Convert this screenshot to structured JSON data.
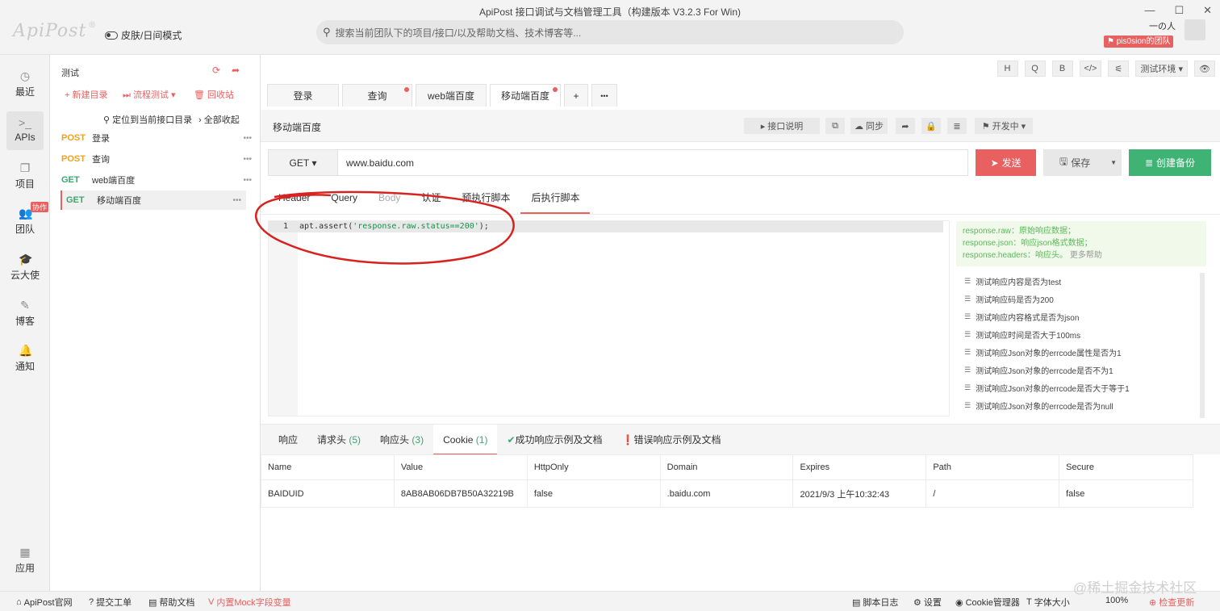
{
  "window": {
    "title": "ApiPost 接口调试与文档管理工具（构建版本 V3.2.3 For Win)",
    "logo": "ApiPost",
    "logo_mark": "®",
    "min": "—",
    "max": "☐",
    "close": "✕"
  },
  "header": {
    "skin_label": "皮肤/日间模式",
    "search_placeholder": "搜索当前团队下的项目/接口/以及帮助文档、技术博客等...",
    "user_name": "一の人",
    "team_badge": "pis0sion的团队"
  },
  "leftnav": {
    "items": [
      {
        "label": "最近",
        "icon": "clock-icon"
      },
      {
        "label": "APIs",
        "icon": "terminal-icon"
      },
      {
        "label": "项目",
        "icon": "project-icon"
      },
      {
        "label": "团队",
        "icon": "team-icon"
      },
      {
        "label": "云大使",
        "icon": "cap-icon"
      },
      {
        "label": "博客",
        "icon": "edit-icon"
      },
      {
        "label": "通知",
        "icon": "bell-icon"
      },
      {
        "label": "应用",
        "icon": "apps-icon"
      }
    ],
    "badge": "协作"
  },
  "tree": {
    "project": "测试",
    "new_dir": "+ 新建目录",
    "flow_test": "⏭ 流程测试",
    "recycle": "回收站",
    "locate": "定位到当前接口目录",
    "collapse": "全部收起",
    "items": [
      {
        "method": "POST",
        "name": "登录"
      },
      {
        "method": "POST",
        "name": "查询"
      },
      {
        "method": "GET",
        "name": "web端百度"
      },
      {
        "method": "GET",
        "name": "移动端百度"
      }
    ],
    "more": "•••"
  },
  "toolbar": {
    "h": "H",
    "q": "Q",
    "b": "B",
    "code": "</>",
    "sliders": "⚟",
    "env": "测试环境",
    "eye": "👁"
  },
  "tabs": {
    "items": [
      "登录",
      "查询",
      "web端百度",
      "移动端百度"
    ],
    "add": "+",
    "more": "•••"
  },
  "api": {
    "title": "移动端百度",
    "doc_btn": "接口说明",
    "sync_btn": "同步",
    "status_btn": "开发中"
  },
  "request": {
    "method": "GET",
    "url": "www.baidu.com",
    "send": "发送",
    "save": "保存",
    "backup": "创建备份"
  },
  "req_tabs": [
    "Header",
    "Query",
    "Body",
    "认证",
    "预执行脚本",
    "后执行脚本"
  ],
  "editor": {
    "line_no": "1",
    "code_pre": "apt.assert(",
    "code_str": "'response.raw.status==200'",
    "code_post": ");"
  },
  "help": {
    "line1": "response.raw：原始响应数据；",
    "line2": "response.json：响应json格式数据；",
    "line3": "response.headers：响应头。",
    "more": "更多帮助"
  },
  "snippets": [
    "测试响应内容是否为test",
    "测试响应码是否为200",
    "测试响应内容格式是否为json",
    "测试响应时间是否大于100ms",
    "测试响应Json对象的errcode属性是否为1",
    "测试响应Json对象的errcode是否不为1",
    "测试响应Json对象的errcode是否大于等于1",
    "测试响应Json对象的errcode是否为null"
  ],
  "res_tabs": {
    "resp": "响应",
    "req_h": "请求头",
    "req_h_n": "(5)",
    "res_h": "响应头",
    "res_h_n": "(3)",
    "cookie": "Cookie",
    "cookie_n": "(1)",
    "ok": "成功响应示例及文档",
    "err": "错误响应示例及文档"
  },
  "cookies": {
    "headers": [
      "Name",
      "Value",
      "HttpOnly",
      "Domain",
      "Expires",
      "Path",
      "Secure"
    ],
    "rows": [
      [
        "BAIDUID",
        "8AB8AB06DB7B50A32219B",
        "false",
        ".baidu.com",
        "2021/9/3 上午10:32:43",
        "/",
        "false"
      ]
    ]
  },
  "status": {
    "site": "ApiPost官网",
    "ticket": "提交工单",
    "docs": "帮助文档",
    "mock": "内置Mock字段变量",
    "log": "脚本日志",
    "settings": "设置",
    "cookie_mgr": "Cookie管理器",
    "font": "字体大小",
    "zoom": "100%",
    "update": "检查更新"
  },
  "watermark": "@稀土掘金技术社区",
  "colors": {
    "accent": "#e96060",
    "green": "#3eb374",
    "post": "#f0a020",
    "get": "#3aa76d"
  }
}
